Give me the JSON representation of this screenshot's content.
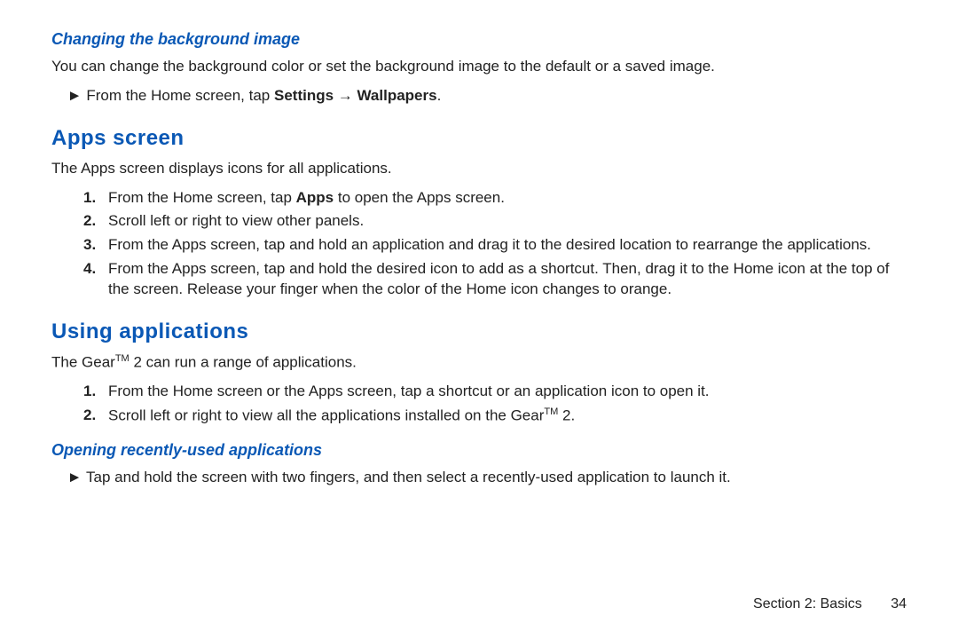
{
  "subheading1": "Changing the background image",
  "para1": "You can change the background color or set the background image to the default or a saved image.",
  "bullet1_prefix": "From the Home screen, tap ",
  "bullet1_bold1": "Settings",
  "bullet1_arrow": " → ",
  "bullet1_bold2": "Wallpapers",
  "bullet1_suffix": ".",
  "heading2": "Apps screen",
  "para2": "The Apps screen displays icons for all applications.",
  "step_a1_prefix": "From the Home screen, tap ",
  "step_a1_bold": "Apps",
  "step_a1_suffix": " to open the Apps screen.",
  "step_a2": "Scroll left or right to view other panels.",
  "step_a3": "From the Apps screen, tap and hold an application and drag it to the desired location to rearrange the applications.",
  "step_a4": "From the Apps screen, tap and hold the desired icon to add as a shortcut. Then, drag it to the Home icon at the top of the screen. Release your finger when the color of the Home icon changes to orange.",
  "heading3": "Using applications",
  "para3_prefix": "The Gear",
  "para3_tm": "TM",
  "para3_suffix": " 2 can run a range of applications.",
  "step_b1": "From the Home screen or the Apps screen, tap a shortcut or an application icon to open it.",
  "step_b2_prefix": "Scroll left or right to view all the applications installed on the Gear",
  "step_b2_tm": "TM",
  "step_b2_suffix": " 2.",
  "subheading4": "Opening recently-used applications",
  "bullet2": "Tap and hold the screen with two fingers, and then select a recently-used application to launch it.",
  "footer_section": "Section 2:  Basics",
  "footer_page": "34",
  "chart_data": null
}
